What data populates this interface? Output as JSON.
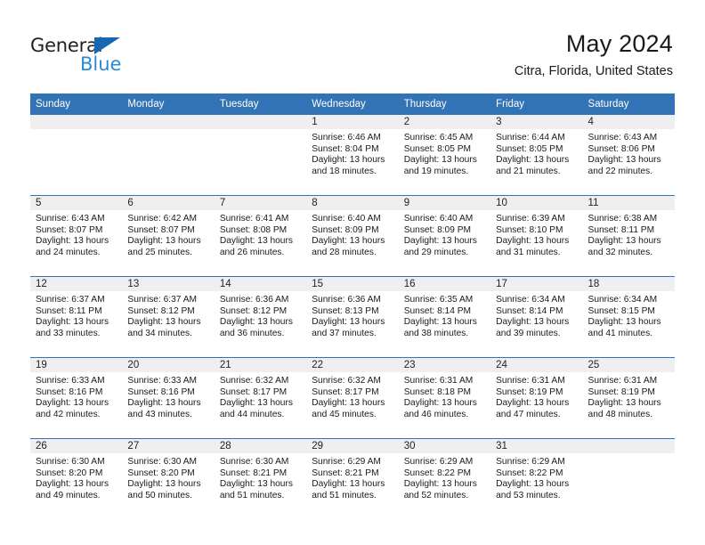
{
  "brand": {
    "name_top": "General",
    "name_bottom": "Blue",
    "accent_color": "#1668b3",
    "accent_color_light": "#2b8bd4"
  },
  "header": {
    "title": "May 2024",
    "subtitle": "Citra, Florida, United States"
  },
  "calendar": {
    "header_bg": "#3273b5",
    "daynum_bg": "#efefef",
    "weekday_headers": [
      "Sunday",
      "Monday",
      "Tuesday",
      "Wednesday",
      "Thursday",
      "Friday",
      "Saturday"
    ],
    "weeks": [
      [
        {
          "day": "",
          "lines": []
        },
        {
          "day": "",
          "lines": []
        },
        {
          "day": "",
          "lines": []
        },
        {
          "day": "1",
          "lines": [
            "Sunrise: 6:46 AM",
            "Sunset: 8:04 PM",
            "Daylight: 13 hours",
            "and 18 minutes."
          ]
        },
        {
          "day": "2",
          "lines": [
            "Sunrise: 6:45 AM",
            "Sunset: 8:05 PM",
            "Daylight: 13 hours",
            "and 19 minutes."
          ]
        },
        {
          "day": "3",
          "lines": [
            "Sunrise: 6:44 AM",
            "Sunset: 8:05 PM",
            "Daylight: 13 hours",
            "and 21 minutes."
          ]
        },
        {
          "day": "4",
          "lines": [
            "Sunrise: 6:43 AM",
            "Sunset: 8:06 PM",
            "Daylight: 13 hours",
            "and 22 minutes."
          ]
        }
      ],
      [
        {
          "day": "5",
          "lines": [
            "Sunrise: 6:43 AM",
            "Sunset: 8:07 PM",
            "Daylight: 13 hours",
            "and 24 minutes."
          ]
        },
        {
          "day": "6",
          "lines": [
            "Sunrise: 6:42 AM",
            "Sunset: 8:07 PM",
            "Daylight: 13 hours",
            "and 25 minutes."
          ]
        },
        {
          "day": "7",
          "lines": [
            "Sunrise: 6:41 AM",
            "Sunset: 8:08 PM",
            "Daylight: 13 hours",
            "and 26 minutes."
          ]
        },
        {
          "day": "8",
          "lines": [
            "Sunrise: 6:40 AM",
            "Sunset: 8:09 PM",
            "Daylight: 13 hours",
            "and 28 minutes."
          ]
        },
        {
          "day": "9",
          "lines": [
            "Sunrise: 6:40 AM",
            "Sunset: 8:09 PM",
            "Daylight: 13 hours",
            "and 29 minutes."
          ]
        },
        {
          "day": "10",
          "lines": [
            "Sunrise: 6:39 AM",
            "Sunset: 8:10 PM",
            "Daylight: 13 hours",
            "and 31 minutes."
          ]
        },
        {
          "day": "11",
          "lines": [
            "Sunrise: 6:38 AM",
            "Sunset: 8:11 PM",
            "Daylight: 13 hours",
            "and 32 minutes."
          ]
        }
      ],
      [
        {
          "day": "12",
          "lines": [
            "Sunrise: 6:37 AM",
            "Sunset: 8:11 PM",
            "Daylight: 13 hours",
            "and 33 minutes."
          ]
        },
        {
          "day": "13",
          "lines": [
            "Sunrise: 6:37 AM",
            "Sunset: 8:12 PM",
            "Daylight: 13 hours",
            "and 34 minutes."
          ]
        },
        {
          "day": "14",
          "lines": [
            "Sunrise: 6:36 AM",
            "Sunset: 8:12 PM",
            "Daylight: 13 hours",
            "and 36 minutes."
          ]
        },
        {
          "day": "15",
          "lines": [
            "Sunrise: 6:36 AM",
            "Sunset: 8:13 PM",
            "Daylight: 13 hours",
            "and 37 minutes."
          ]
        },
        {
          "day": "16",
          "lines": [
            "Sunrise: 6:35 AM",
            "Sunset: 8:14 PM",
            "Daylight: 13 hours",
            "and 38 minutes."
          ]
        },
        {
          "day": "17",
          "lines": [
            "Sunrise: 6:34 AM",
            "Sunset: 8:14 PM",
            "Daylight: 13 hours",
            "and 39 minutes."
          ]
        },
        {
          "day": "18",
          "lines": [
            "Sunrise: 6:34 AM",
            "Sunset: 8:15 PM",
            "Daylight: 13 hours",
            "and 41 minutes."
          ]
        }
      ],
      [
        {
          "day": "19",
          "lines": [
            "Sunrise: 6:33 AM",
            "Sunset: 8:16 PM",
            "Daylight: 13 hours",
            "and 42 minutes."
          ]
        },
        {
          "day": "20",
          "lines": [
            "Sunrise: 6:33 AM",
            "Sunset: 8:16 PM",
            "Daylight: 13 hours",
            "and 43 minutes."
          ]
        },
        {
          "day": "21",
          "lines": [
            "Sunrise: 6:32 AM",
            "Sunset: 8:17 PM",
            "Daylight: 13 hours",
            "and 44 minutes."
          ]
        },
        {
          "day": "22",
          "lines": [
            "Sunrise: 6:32 AM",
            "Sunset: 8:17 PM",
            "Daylight: 13 hours",
            "and 45 minutes."
          ]
        },
        {
          "day": "23",
          "lines": [
            "Sunrise: 6:31 AM",
            "Sunset: 8:18 PM",
            "Daylight: 13 hours",
            "and 46 minutes."
          ]
        },
        {
          "day": "24",
          "lines": [
            "Sunrise: 6:31 AM",
            "Sunset: 8:19 PM",
            "Daylight: 13 hours",
            "and 47 minutes."
          ]
        },
        {
          "day": "25",
          "lines": [
            "Sunrise: 6:31 AM",
            "Sunset: 8:19 PM",
            "Daylight: 13 hours",
            "and 48 minutes."
          ]
        }
      ],
      [
        {
          "day": "26",
          "lines": [
            "Sunrise: 6:30 AM",
            "Sunset: 8:20 PM",
            "Daylight: 13 hours",
            "and 49 minutes."
          ]
        },
        {
          "day": "27",
          "lines": [
            "Sunrise: 6:30 AM",
            "Sunset: 8:20 PM",
            "Daylight: 13 hours",
            "and 50 minutes."
          ]
        },
        {
          "day": "28",
          "lines": [
            "Sunrise: 6:30 AM",
            "Sunset: 8:21 PM",
            "Daylight: 13 hours",
            "and 51 minutes."
          ]
        },
        {
          "day": "29",
          "lines": [
            "Sunrise: 6:29 AM",
            "Sunset: 8:21 PM",
            "Daylight: 13 hours",
            "and 51 minutes."
          ]
        },
        {
          "day": "30",
          "lines": [
            "Sunrise: 6:29 AM",
            "Sunset: 8:22 PM",
            "Daylight: 13 hours",
            "and 52 minutes."
          ]
        },
        {
          "day": "31",
          "lines": [
            "Sunrise: 6:29 AM",
            "Sunset: 8:22 PM",
            "Daylight: 13 hours",
            "and 53 minutes."
          ]
        },
        {
          "day": "",
          "lines": []
        }
      ]
    ]
  }
}
